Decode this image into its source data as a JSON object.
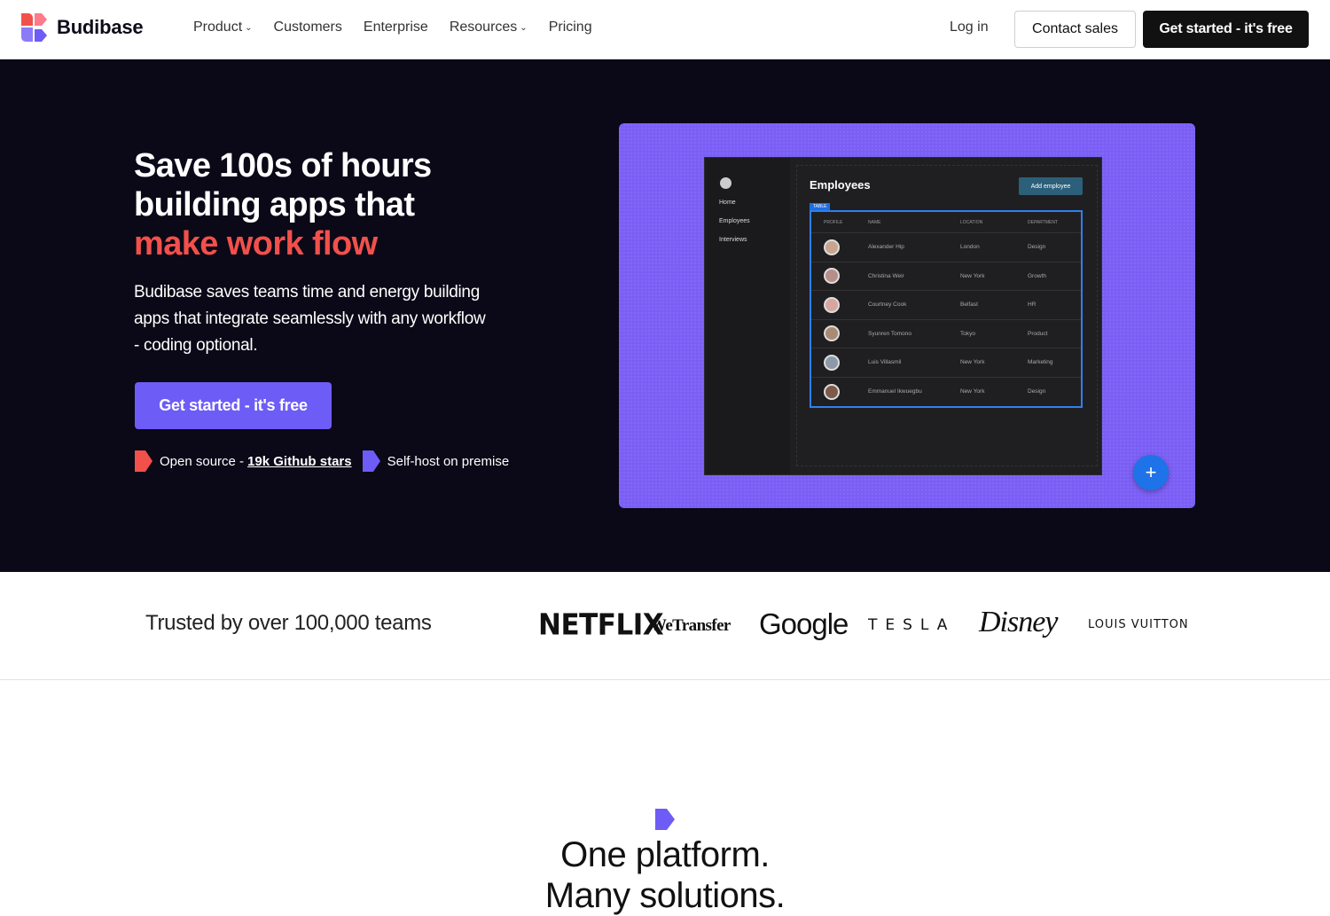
{
  "brand": {
    "name": "Budibase"
  },
  "nav": {
    "items": [
      {
        "label": "Product",
        "dropdown": true
      },
      {
        "label": "Customers",
        "dropdown": false
      },
      {
        "label": "Enterprise",
        "dropdown": false
      },
      {
        "label": "Resources",
        "dropdown": true
      },
      {
        "label": "Pricing",
        "dropdown": false
      }
    ],
    "login": "Log in",
    "contact": "Contact sales",
    "get_started": "Get started - it's free"
  },
  "hero": {
    "title_line1": "Save 100s of hours",
    "title_line2": "building apps that",
    "title_accent": "make work flow",
    "subtitle": "Budibase saves teams time and energy building apps that integrate seamlessly with any workflow - coding optional.",
    "cta": "Get started - it's free",
    "badge1_text": "Open source -",
    "badge1_link": "19k Github stars",
    "badge2_text": "Self-host on premise"
  },
  "preview": {
    "nav": [
      "Home",
      "Employees",
      "Interviews"
    ],
    "title": "Employees",
    "add_button": "Add employee",
    "table_tag": "TABLE",
    "columns": [
      "PROFILE",
      "NAME",
      "LOCATION",
      "DEPARTMENT"
    ],
    "rows": [
      {
        "name": "Alexander Hip",
        "location": "London",
        "department": "Design"
      },
      {
        "name": "Christina Weir",
        "location": "New York",
        "department": "Growth"
      },
      {
        "name": "Courtney Cook",
        "location": "Belfast",
        "department": "HR"
      },
      {
        "name": "Syunren Tomono",
        "location": "Tokyo",
        "department": "Product"
      },
      {
        "name": "Luis Villasmil",
        "location": "New York",
        "department": "Marketing"
      },
      {
        "name": "Emmanuel Ikwuegbu",
        "location": "New York",
        "department": "Design"
      }
    ],
    "fab": "+"
  },
  "trusted": {
    "text": "Trusted by over 100,000 teams",
    "logos": [
      "NETFLIX",
      "WeTransfer",
      "Google",
      "TESLA",
      "Disney",
      "LOUIS VUITTON"
    ]
  },
  "section": {
    "title_line1": "One platform.",
    "title_line2": "Many solutions."
  },
  "colors": {
    "accent": "#f2504b",
    "primary": "#6d5cf6",
    "hero_bg": "#0b0817",
    "visual_bg": "#7b5ff5"
  }
}
